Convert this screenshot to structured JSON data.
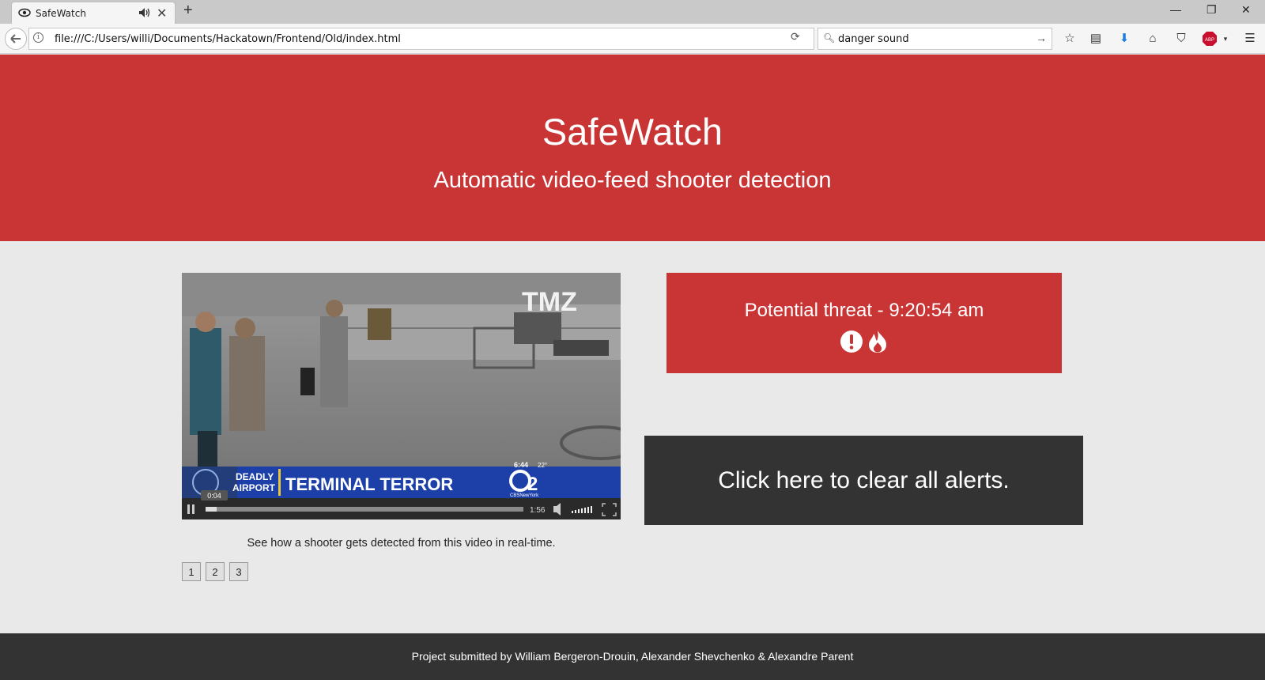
{
  "browser": {
    "tab_title": "SafeWatch",
    "url": "file:///C:/Users/willi/Documents/Hackatown/Frontend/Old/index.html",
    "search_value": "danger sound"
  },
  "header": {
    "title": "SafeWatch",
    "subtitle": "Automatic video-feed shooter detection"
  },
  "video": {
    "overlay_logo": "TMZ",
    "ticker_left_top": "DEADLY",
    "ticker_left_bottom": "AIRPORT",
    "ticker_headline": "TERMINAL TERROR",
    "ticker_time": "6:44",
    "ticker_temp": "22°",
    "channel": "2",
    "channel_handle": "CBSNewYork",
    "current_time": "0:04",
    "duration": "1:56",
    "progress": 0.035
  },
  "caption": "See how a shooter gets detected from this video in real-time.",
  "pager": [
    "1",
    "2",
    "3"
  ],
  "alert": {
    "text": "Potential threat - 9:20:54 am",
    "icons": [
      "exclamation-circle-icon",
      "fire-icon"
    ]
  },
  "clear_button": "Click here to clear all alerts.",
  "footer": "Project submitted by William Bergeron-Drouin, Alexander Shevchenko & Alexandre Parent",
  "colors": {
    "brand_red": "#c93535",
    "dark": "#333333",
    "page_bg": "#e9e9e9"
  }
}
